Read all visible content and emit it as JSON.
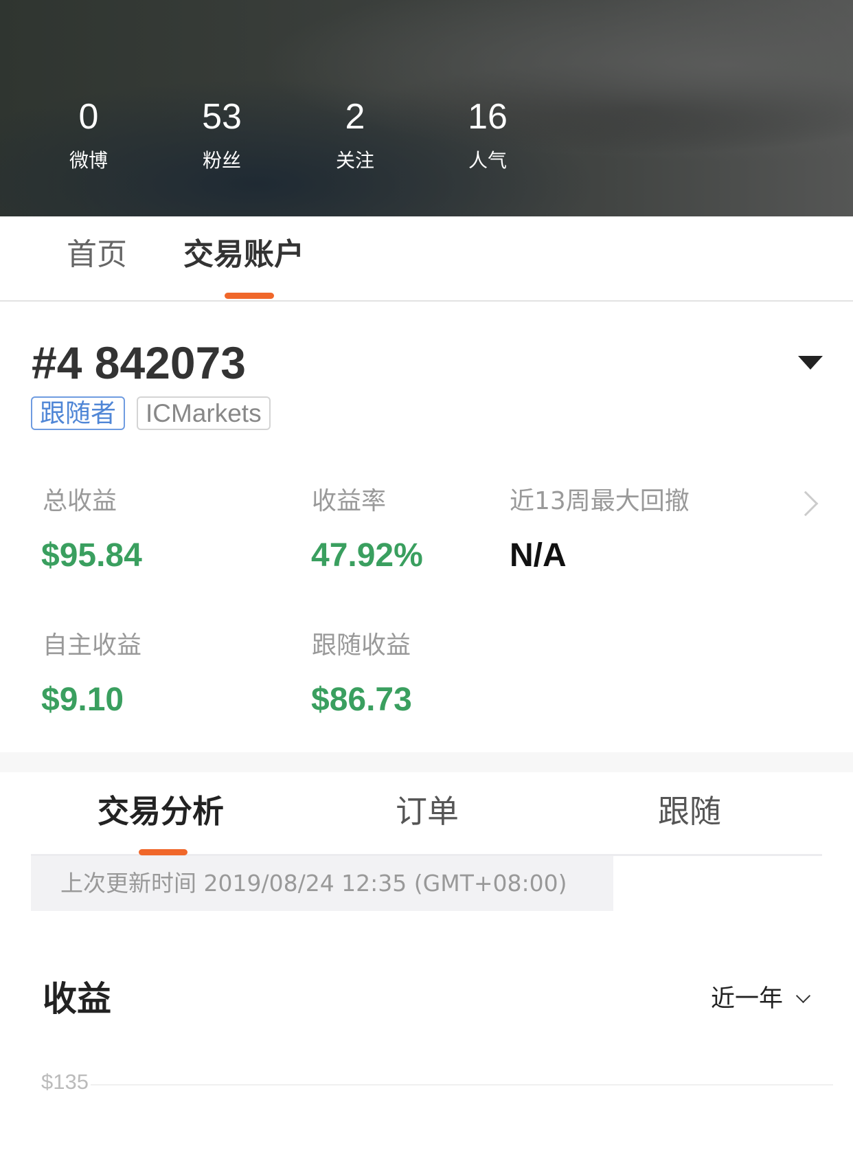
{
  "profile_stats": [
    {
      "value": "0",
      "label": "微博"
    },
    {
      "value": "53",
      "label": "粉丝"
    },
    {
      "value": "2",
      "label": "关注"
    },
    {
      "value": "16",
      "label": "人气"
    }
  ],
  "main_tabs": [
    {
      "label": "首页",
      "active": false
    },
    {
      "label": "交易账户",
      "active": true
    }
  ],
  "account": {
    "number": "#4 842073",
    "badges": [
      "跟随者",
      "ICMarkets"
    ],
    "metrics": [
      {
        "label": "总收益",
        "value": "$95.84"
      },
      {
        "label": "收益率",
        "value": "47.92%"
      },
      {
        "label": "近13周最大回撤",
        "value": "N/A"
      },
      {
        "label": "自主收益",
        "value": "$9.10"
      },
      {
        "label": "跟随收益",
        "value": "$86.73"
      }
    ]
  },
  "sub_tabs": [
    {
      "label": "交易分析",
      "active": true
    },
    {
      "label": "订单",
      "active": false
    },
    {
      "label": "跟随",
      "active": false
    }
  ],
  "last_updated": "上次更新时间 2019/08/24 12:35 (GMT+08:00)",
  "revenue": {
    "title": "收益",
    "range": "近一年",
    "y_tick": "$135"
  },
  "colors": {
    "accent": "#f0672a",
    "positive": "#3a9f5f",
    "badge_blue": "#4f86d6"
  }
}
